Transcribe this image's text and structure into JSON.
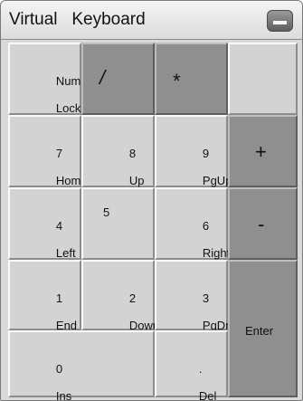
{
  "window": {
    "title": "Virtual   Keyboard"
  },
  "keys": {
    "num_lock": {
      "line1": "Num",
      "line2": "Lock"
    },
    "slash": "/",
    "asterisk": "*",
    "blank": "",
    "k7": {
      "line1": "7",
      "line2": "Home"
    },
    "k8": {
      "line1": "8",
      "line2": "Up"
    },
    "k9": {
      "line1": "9",
      "line2": "PgUp"
    },
    "plus": "+",
    "k4": {
      "line1": "4",
      "line2": "Left"
    },
    "k5": "5",
    "k6": {
      "line1": "6",
      "line2": "Right"
    },
    "minus": "-",
    "k1": {
      "line1": "1",
      "line2": "End"
    },
    "k2": {
      "line1": "2",
      "line2": "Down"
    },
    "k3": {
      "line1": "3",
      "line2": "PgDn"
    },
    "enter": "Enter",
    "k0": {
      "line1": "0",
      "line2": "Ins"
    },
    "dot": {
      "line1": ".",
      "line2": "Del"
    }
  }
}
